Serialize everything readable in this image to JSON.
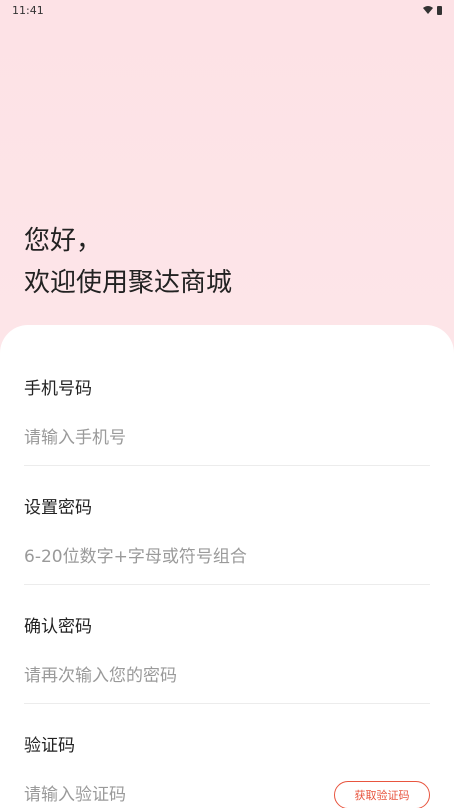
{
  "status_bar": {
    "time": "11:41",
    "icons": [
      "wifi-icon",
      "battery-icon"
    ]
  },
  "greeting": {
    "line1": "您好，",
    "line2": "欢迎使用聚达商城"
  },
  "form": {
    "phone": {
      "label": "手机号码",
      "placeholder": "请输入手机号"
    },
    "password": {
      "label": "设置密码",
      "placeholder": "6-20位数字+字母或符号组合"
    },
    "confirm": {
      "label": "确认密码",
      "placeholder": "请再次输入您的密码"
    },
    "code": {
      "label": "验证码",
      "placeholder": "请输入验证码",
      "button_label": "获取验证码"
    }
  },
  "colors": {
    "accent": "#e8553f",
    "background_top": "#fde2e6"
  }
}
